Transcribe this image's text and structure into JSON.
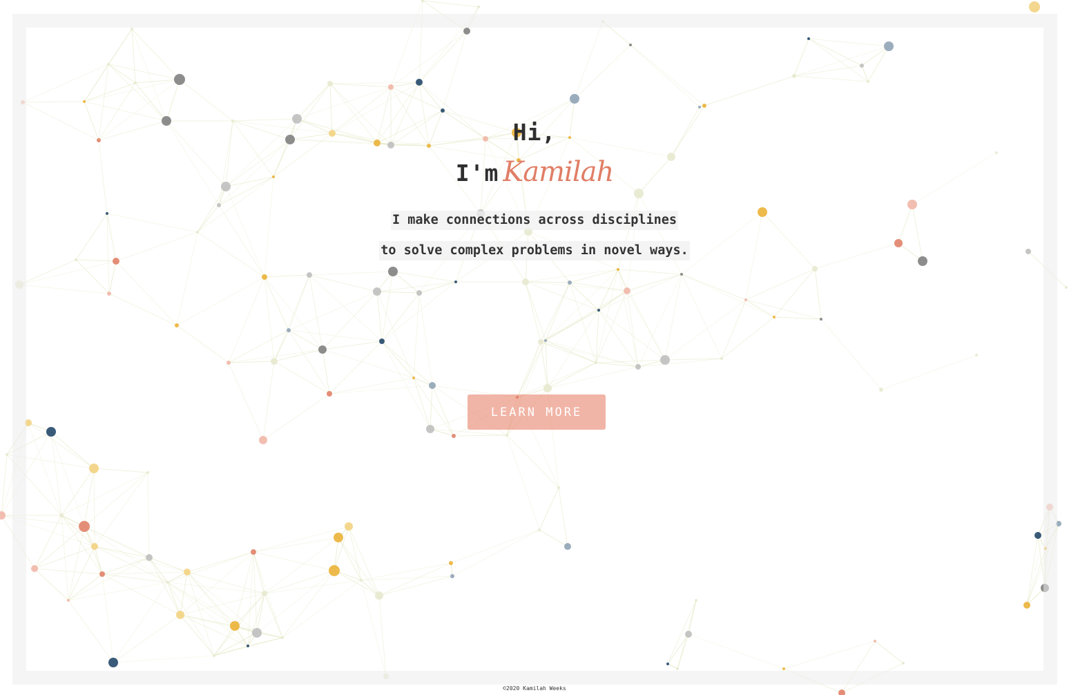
{
  "hero": {
    "greeting": "Hi,",
    "intro_prefix": "I'm",
    "name": "Kamilah",
    "tagline_line1": "I make connections across disciplines",
    "tagline_line2": "to solve complex problems in novel ways.",
    "cta_label": "LEARN MORE"
  },
  "footer": {
    "copyright": "©2020 Kamilah Weeks"
  },
  "colors": {
    "accent_coral": "#e07e66",
    "accent_gold": "#eab133",
    "accent_navy": "#1f4466",
    "accent_gray": "#7d7d7d",
    "link_line": "#e6e8c8",
    "text": "#2f2f2f",
    "frame": "#ececec"
  },
  "background": {
    "description_icon": "network-graph-background"
  }
}
